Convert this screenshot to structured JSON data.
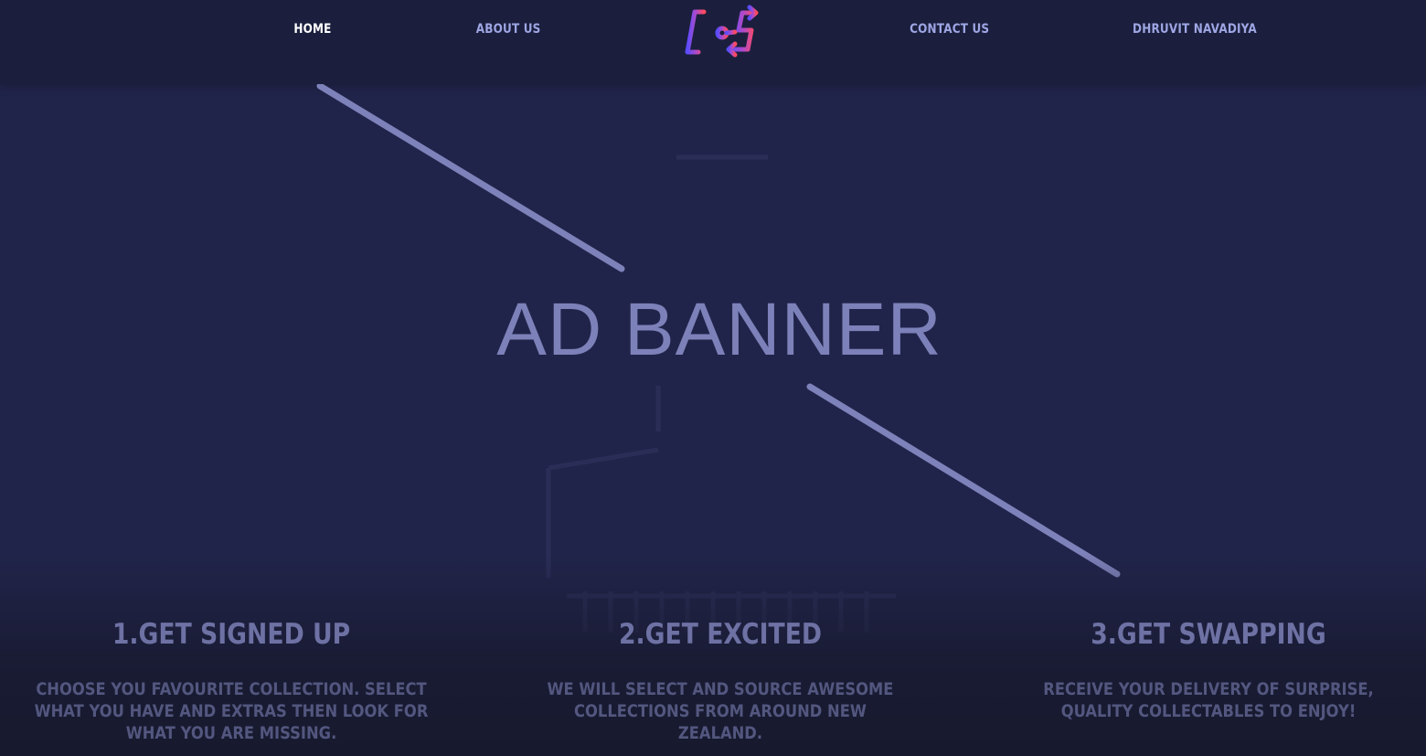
{
  "nav": {
    "links": [
      {
        "label": "HOME",
        "active": true
      },
      {
        "label": "ABOUT US",
        "active": false
      },
      {
        "label": "CONTACT US",
        "active": false
      },
      {
        "label": "DHRUVIT NAVADIYA",
        "active": false
      }
    ],
    "logo_icon": "collection-swap-logo"
  },
  "hero": {
    "banner_text": "AD BANNER"
  },
  "steps": [
    {
      "title": "1.GET SIGNED UP",
      "description": "CHOOSE YOU FAVOURITE COLLECTION. SELECT WHAT YOU HAVE AND EXTRAS THEN LOOK FOR WHAT YOU ARE MISSING."
    },
    {
      "title": "2.GET EXCITED",
      "description": "WE WILL SELECT AND SOURCE AWESOME COLLECTIONS FROM AROUND NEW ZEALAND."
    },
    {
      "title": "3.GET SWAPPING",
      "description": "RECEIVE YOUR DELIVERY OF SURPRISE, QUALITY COLLECTABLES TO ENJOY!"
    }
  ],
  "colors": {
    "background": "#21244a",
    "nav_background": "#1b1f3d",
    "nav_link": "#9ea6e4",
    "nav_active": "#ffffff",
    "banner_text": "#7c81b9",
    "logo_gradient_start": "#5b4dff",
    "logo_gradient_end": "#ff4a5e"
  }
}
